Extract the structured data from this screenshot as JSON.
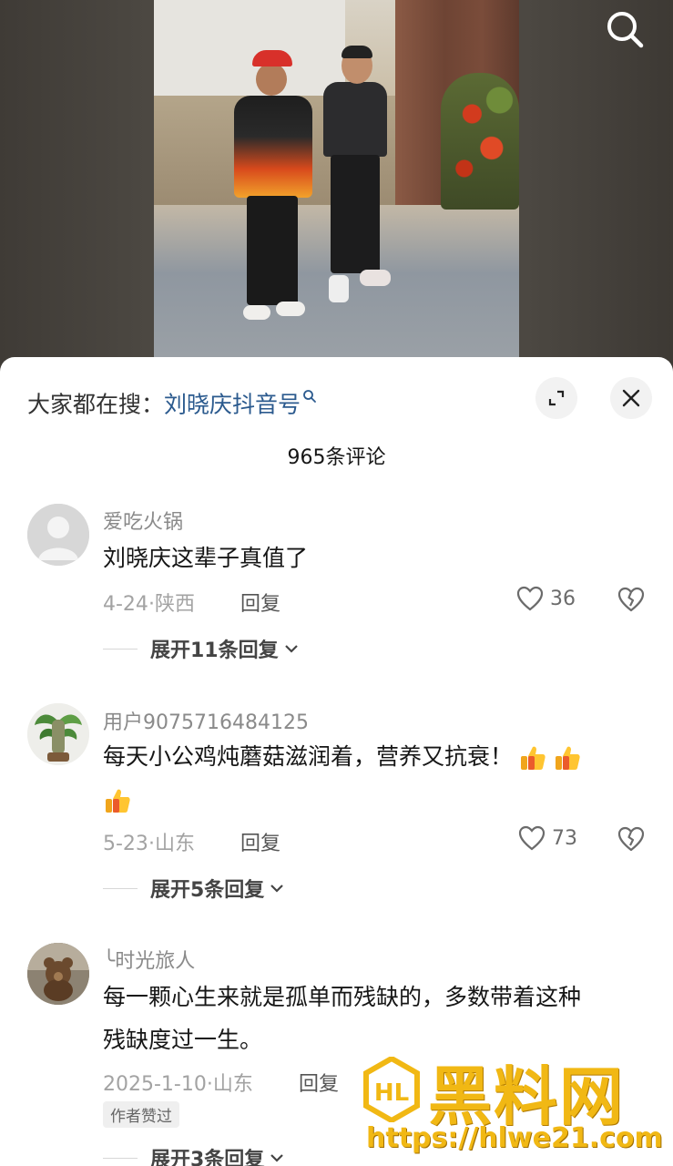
{
  "hot_search": {
    "prefix": "大家都在搜：",
    "term": "刘晓庆抖音号"
  },
  "comment_count": "965条评论",
  "comments": [
    {
      "username": "爱吃火锅",
      "text": "刘晓庆这辈子真值了",
      "date": "4-24",
      "location": "陕西",
      "reply_label": "回复",
      "likes": "36",
      "expand": "展开11条回复"
    },
    {
      "username": "用户9075716484125",
      "text": "每天小公鸡炖蘑菇滋润着，营养又抗衰！",
      "emoji_count": 3,
      "date": "5-23",
      "location": "山东",
      "reply_label": "回复",
      "likes": "73",
      "expand": "展开5条回复"
    },
    {
      "username": "╰时光旅人",
      "text_line1": "每一颗心生来就是孤单而残缺的，多数带着这种",
      "text_line2": "残缺度过一生。",
      "date": "2025-1-10",
      "location": "山东",
      "reply_label": "回复",
      "badge": "作者赞过",
      "expand": "展开3条回复"
    }
  ],
  "watermark": {
    "brand": "黑料网",
    "url": "https://hlwe21.com"
  },
  "colors": {
    "link_blue": "#2b5a8e",
    "watermark_gold": "#f1b814"
  }
}
